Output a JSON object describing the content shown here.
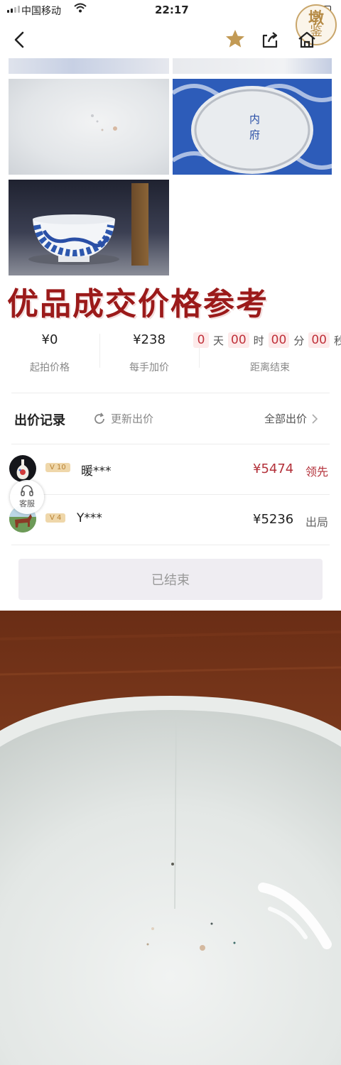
{
  "status_bar": {
    "carrier": "中国移动",
    "time": "22:17"
  },
  "logo": {
    "line1": "墩",
    "line2": "鉴"
  },
  "nav": {
    "back_icon": "chevron-left-icon",
    "favorite_icon": "star-icon",
    "share_icon": "share-icon",
    "home_icon": "home-icon",
    "favorite_color": "#c29a55"
  },
  "headline": "优品成交价格参考",
  "price_info": {
    "start_price": {
      "value": "¥0",
      "label": "起拍价格"
    },
    "increment": {
      "value": "¥238",
      "label": "每手加价"
    },
    "countdown": {
      "days": "0",
      "days_unit": "天",
      "hours": "00",
      "hours_unit": "时",
      "minutes": "00",
      "minutes_unit": "分",
      "seconds": "00",
      "seconds_unit": "秒",
      "label": "距离结束"
    }
  },
  "bid_records": {
    "title": "出价记录",
    "refresh_label": "更新出价",
    "all_label": "全部出价",
    "rows": [
      {
        "level": "V 10",
        "user": "暖***",
        "price": "¥5474",
        "status": "领先",
        "price_color": "#b3313a"
      },
      {
        "level": "V 4",
        "user": "Y***",
        "price": "¥5236",
        "status": "出局",
        "price_color": "#222222"
      }
    ]
  },
  "customer_service": {
    "label": "客服"
  },
  "end_button": {
    "label": "已结束"
  },
  "photo_text": {
    "bowl_mark": "内府"
  }
}
